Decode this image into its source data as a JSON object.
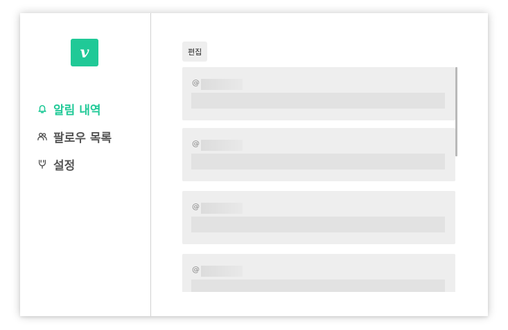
{
  "app": {
    "logo_letter": "v",
    "brand_color": "#20c997"
  },
  "sidebar": {
    "items": [
      {
        "label": "알림 내역",
        "icon": "bell-icon",
        "active": true
      },
      {
        "label": "팔로우 목록",
        "icon": "users-icon",
        "active": false
      },
      {
        "label": "설정",
        "icon": "settings-icon",
        "active": false
      }
    ]
  },
  "main": {
    "edit_label": "편집",
    "notifications": [
      {
        "at_symbol": "@"
      },
      {
        "at_symbol": "@"
      },
      {
        "at_symbol": "@"
      },
      {
        "at_symbol": "@"
      }
    ]
  },
  "colors": {
    "card_background": "#eeeeee",
    "skeleton": "#e2e2e2",
    "nav_inactive": "#555555",
    "divider": "#d0d0d0"
  }
}
